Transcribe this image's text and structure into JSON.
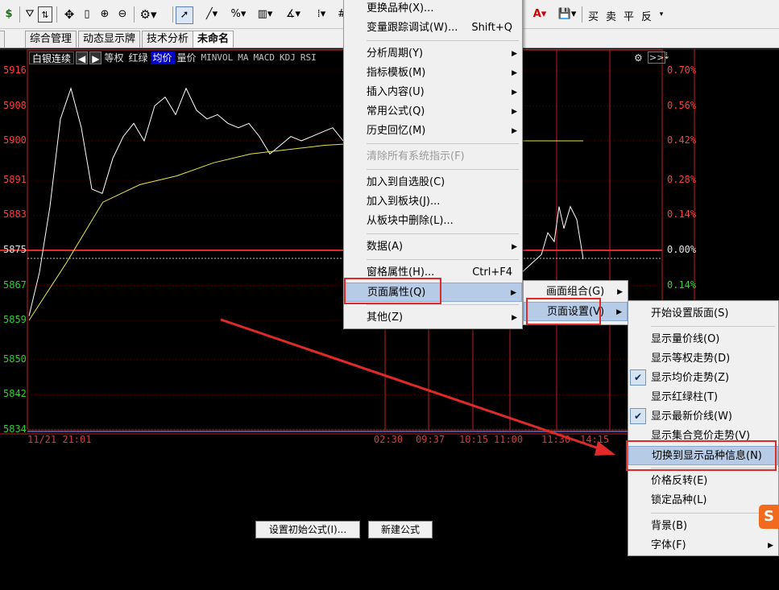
{
  "toolbar": {
    "dollar": "$",
    "right_labels": [
      "买",
      "卖",
      "平",
      "反"
    ]
  },
  "tabs": [
    {
      "label": "综合管理"
    },
    {
      "label": "动态显示牌"
    },
    {
      "label": "技术分析"
    },
    {
      "label": "未命名"
    }
  ],
  "chart_header": {
    "name": "白银连续",
    "buttons": [
      "等权",
      "红绿",
      "均价",
      "量价",
      "MINVOL",
      "MA",
      "MACD",
      "KDJ",
      "RSI"
    ]
  },
  "chart_data": {
    "type": "line",
    "y_ticks": [
      "5916",
      "5908",
      "5900",
      "5891",
      "5883",
      "5875",
      "5867",
      "5859",
      "5850",
      "5842",
      "5834"
    ],
    "right_ticks": [
      "0.70%",
      "0.56%",
      "0.42%",
      "0.28%",
      "0.14%",
      "0.00%",
      "0.14%"
    ],
    "x_ticks": [
      "11/21 21:01",
      "02:30",
      "09:37",
      "10:15",
      "11:00",
      "11:30",
      "14:15"
    ],
    "ylim": [
      5834,
      5916
    ],
    "reference": 5875,
    "series": [
      {
        "color": "#ffffff",
        "values": [
          5860,
          5870,
          5885,
          5905,
          5912,
          5903,
          5889,
          5888,
          5896,
          5901,
          5904,
          5900,
          5908,
          5910,
          5906,
          5912,
          5907,
          5905,
          5906,
          5904,
          5903,
          5904,
          5901,
          5897,
          5899,
          5901,
          5900,
          5901,
          5902,
          5903,
          5900
        ]
      },
      {
        "color": "#e6e64a",
        "values": [
          5859,
          5872,
          5886,
          5890,
          5892,
          5895,
          5897,
          5898,
          5899,
          5899.5,
          5900,
          5900,
          5900,
          5900,
          5900,
          5900
        ]
      }
    ]
  },
  "bottom_buttons": [
    "设置初始公式(I)...",
    "新建公式(N)"
  ],
  "menu_main": [
    {
      "label": "更换品种(X)..."
    },
    {
      "label": "变量跟踪调试(W)...",
      "shortcut": "Shift+Q"
    },
    {
      "label": "分析周期(Y)"
    },
    {
      "label": "指标模板(M)"
    },
    {
      "label": "插入内容(U)"
    },
    {
      "label": "常用公式(Q)"
    },
    {
      "label": "历史回忆(M)"
    },
    {
      "label": "清除所有系统指示(F)"
    },
    {
      "label": "加入到自选股(C)"
    },
    {
      "label": "加入到板块(J)..."
    },
    {
      "label": "从板块中删除(L)..."
    },
    {
      "label": "数据(A)"
    },
    {
      "label": "窗格属性(H)...",
      "shortcut": "Ctrl+F4"
    },
    {
      "label": "页面属性(Q)"
    },
    {
      "label": "其他(Z)"
    }
  ],
  "menu_page": [
    {
      "label": "画面组合(G)"
    },
    {
      "label": "页面设置(V)"
    }
  ],
  "menu_settings": [
    {
      "label": "开始设置版面(S)"
    },
    {
      "label": "显示量价线(O)"
    },
    {
      "label": "显示等权走势(D)"
    },
    {
      "label": "显示均价走势(Z)"
    },
    {
      "label": "显示红绿柱(T)"
    },
    {
      "label": "显示最新价线(W)"
    },
    {
      "label": "显示集合竞价走势(V)"
    },
    {
      "label": "切换到显示品种信息(N)"
    },
    {
      "label": "价格反转(E)"
    },
    {
      "label": "锁定品种(L)"
    },
    {
      "label": "背景(B)"
    },
    {
      "label": "字体(F)"
    }
  ],
  "colors": {
    "up": "#ff3c3c",
    "down": "#30d030",
    "avg_line": "#e6e64a",
    "menu_highlight": "#b6cbe6",
    "annotation": "#e02a2a"
  }
}
